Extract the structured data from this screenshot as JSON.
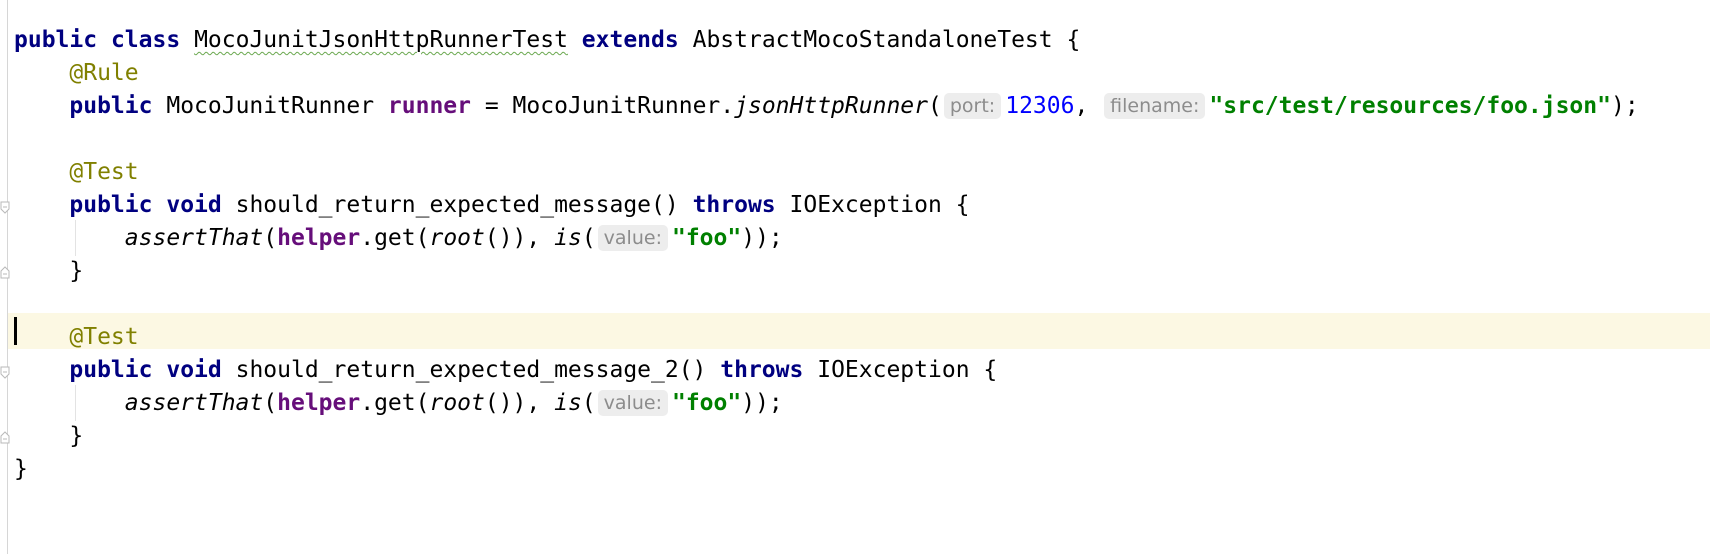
{
  "editor": {
    "class_decl": {
      "kw_public": "public",
      "kw_class": "class",
      "class_name": "MocoJunitJsonHttpRunnerTest",
      "kw_extends": "extends",
      "super_name": "AbstractMocoStandaloneTest",
      "brace": " {"
    },
    "rule_annotation": "@Rule",
    "runner_decl": {
      "kw_public": "public",
      "type": "MocoJunitRunner",
      "field": "runner",
      "assign": " = MocoJunitRunner.",
      "method": "jsonHttpRunner",
      "open": "(",
      "hint_port": "port:",
      "port_value": "12306",
      "comma": ", ",
      "hint_filename": "filename:",
      "filename_value": "\"src/test/resources/foo.json\"",
      "close": ");"
    },
    "test1": {
      "annotation": "@Test",
      "kw_public": "public",
      "kw_void": "void",
      "signature": "should_return_expected_message()",
      "kw_throws": "throws",
      "exception": "IOException {",
      "call_assert": "assertThat",
      "paren1": "(",
      "helper": "helper",
      "get": ".get(",
      "root": "root",
      "after_root": "()), ",
      "is": "is",
      "paren2": "(",
      "hint_value": "value:",
      "value": "\"foo\"",
      "close": "));",
      "end_brace": "}"
    },
    "test2": {
      "annotation": "@Test",
      "kw_public": "public",
      "kw_void": "void",
      "signature": "should_return_expected_message_2()",
      "kw_throws": "throws",
      "exception": "IOException {",
      "call_assert": "assertThat",
      "paren1": "(",
      "helper": "helper",
      "get": ".get(",
      "root": "root",
      "after_root": "()), ",
      "is": "is",
      "paren2": "(",
      "hint_value": "value:",
      "value": "\"foo\"",
      "close": "));",
      "end_brace": "}"
    },
    "class_end_brace": "}"
  },
  "colors": {
    "keyword": "#000080",
    "annotation": "#808000",
    "field": "#660e7a",
    "number": "#0000ff",
    "string": "#008000",
    "current_line": "#fcf8e3",
    "hint_bg": "#ededed"
  }
}
